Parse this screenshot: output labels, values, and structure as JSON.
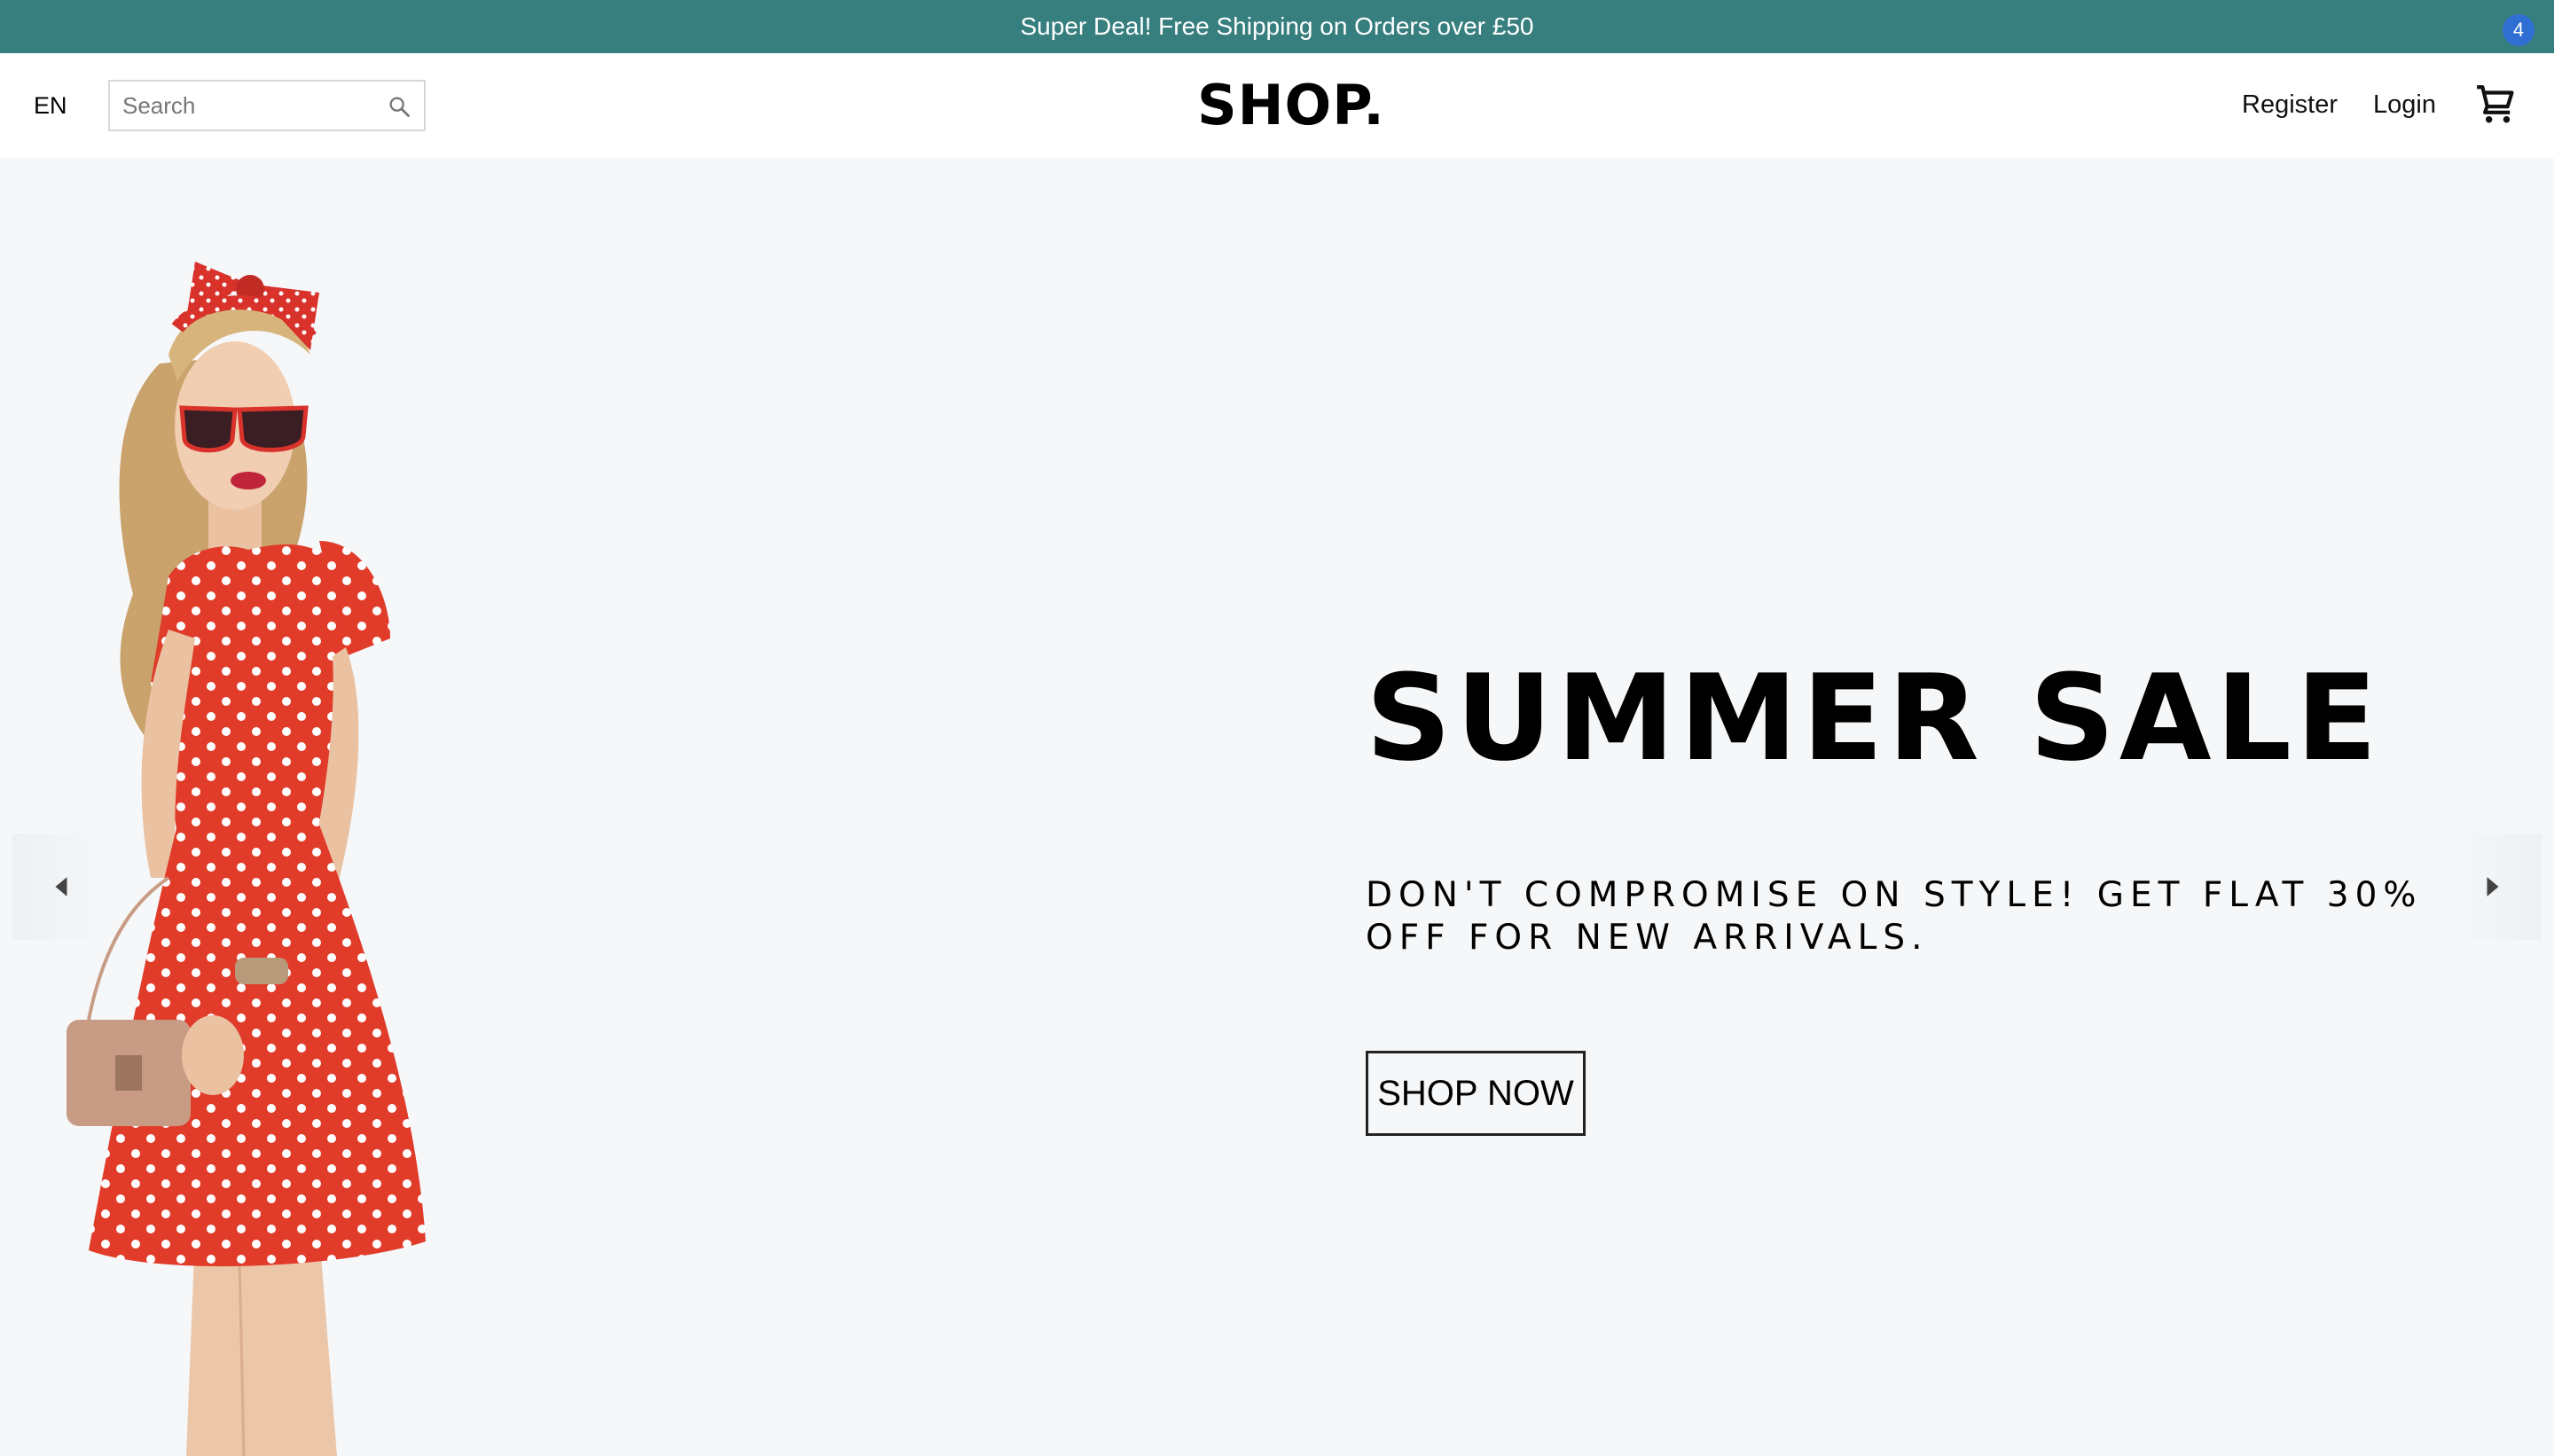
{
  "announcement": {
    "text": "Super Deal! Free Shipping on Orders over £50"
  },
  "navbar": {
    "language": "EN",
    "search": {
      "placeholder": "Search",
      "value": ""
    },
    "logo": "SHOP.",
    "register_label": "Register",
    "login_label": "Login",
    "cart_count": "4"
  },
  "slider": {
    "title": "SUMMER SALE",
    "description": "DON'T COMPROMISE ON STYLE! GET FLAT 30% OFF FOR NEW ARRIVALS.",
    "button_label": "SHOP NOW",
    "background_color": "#f5f7f9"
  },
  "colors": {
    "announcement_bg": "#377e7e",
    "badge": "#2f6fd4",
    "dress": "#e13b2a"
  },
  "icons": [
    "search-icon",
    "cart-icon",
    "arrow-left-icon",
    "arrow-right-icon"
  ]
}
